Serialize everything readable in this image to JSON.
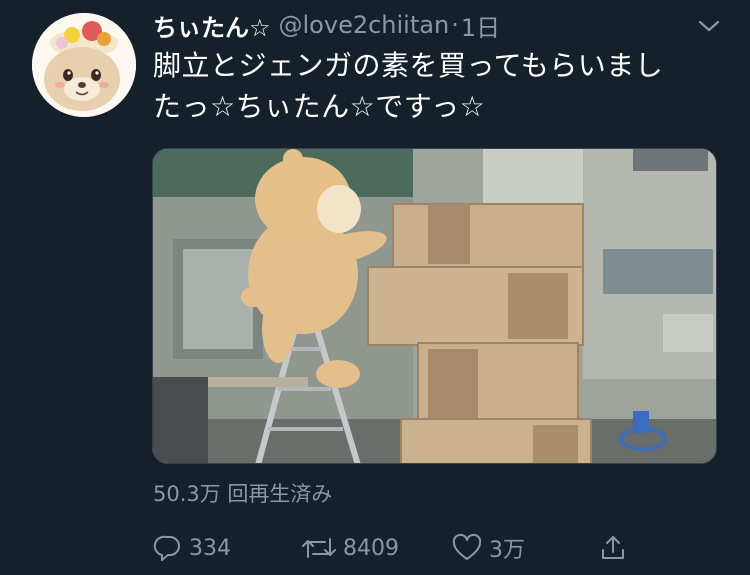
{
  "tweet": {
    "display_name": "ちぃたん☆",
    "handle": "@love2chiitan",
    "separator": "·",
    "time": "1日",
    "text_lines": [
      "脚立とジェンガの素を買ってもらいまし",
      "たっ☆ちぃたん☆ですっ☆"
    ],
    "views": "50.3万 回再生済み",
    "reply_count": "334",
    "retweet_count": "8409",
    "like_count": "3万"
  },
  "icons": {
    "menu": "chevron-down-icon",
    "reply": "reply-icon",
    "retweet": "retweet-icon",
    "like": "heart-icon",
    "share": "share-icon"
  },
  "colors": {
    "background": "#15202b",
    "secondary_text": "#8899a6",
    "primary_text": "#ffffff"
  }
}
